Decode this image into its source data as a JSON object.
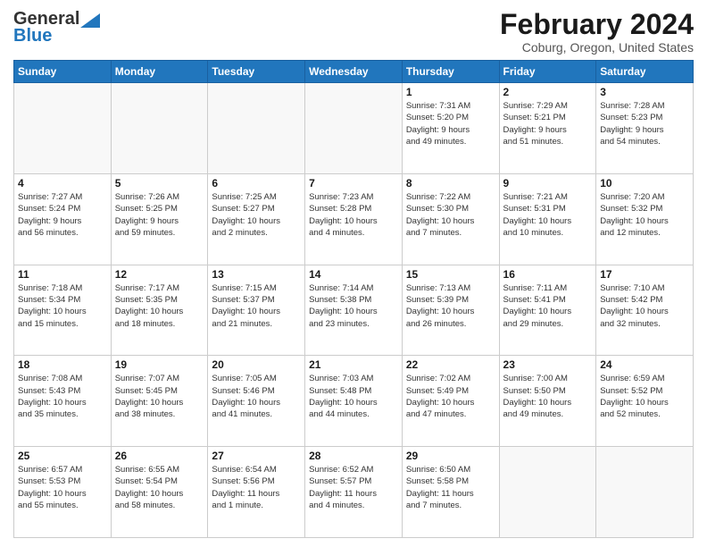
{
  "header": {
    "logo_general": "General",
    "logo_blue": "Blue",
    "month_title": "February 2024",
    "location": "Coburg, Oregon, United States"
  },
  "days_of_week": [
    "Sunday",
    "Monday",
    "Tuesday",
    "Wednesday",
    "Thursday",
    "Friday",
    "Saturday"
  ],
  "weeks": [
    [
      {
        "day": "",
        "info": ""
      },
      {
        "day": "",
        "info": ""
      },
      {
        "day": "",
        "info": ""
      },
      {
        "day": "",
        "info": ""
      },
      {
        "day": "1",
        "info": "Sunrise: 7:31 AM\nSunset: 5:20 PM\nDaylight: 9 hours\nand 49 minutes."
      },
      {
        "day": "2",
        "info": "Sunrise: 7:29 AM\nSunset: 5:21 PM\nDaylight: 9 hours\nand 51 minutes."
      },
      {
        "day": "3",
        "info": "Sunrise: 7:28 AM\nSunset: 5:23 PM\nDaylight: 9 hours\nand 54 minutes."
      }
    ],
    [
      {
        "day": "4",
        "info": "Sunrise: 7:27 AM\nSunset: 5:24 PM\nDaylight: 9 hours\nand 56 minutes."
      },
      {
        "day": "5",
        "info": "Sunrise: 7:26 AM\nSunset: 5:25 PM\nDaylight: 9 hours\nand 59 minutes."
      },
      {
        "day": "6",
        "info": "Sunrise: 7:25 AM\nSunset: 5:27 PM\nDaylight: 10 hours\nand 2 minutes."
      },
      {
        "day": "7",
        "info": "Sunrise: 7:23 AM\nSunset: 5:28 PM\nDaylight: 10 hours\nand 4 minutes."
      },
      {
        "day": "8",
        "info": "Sunrise: 7:22 AM\nSunset: 5:30 PM\nDaylight: 10 hours\nand 7 minutes."
      },
      {
        "day": "9",
        "info": "Sunrise: 7:21 AM\nSunset: 5:31 PM\nDaylight: 10 hours\nand 10 minutes."
      },
      {
        "day": "10",
        "info": "Sunrise: 7:20 AM\nSunset: 5:32 PM\nDaylight: 10 hours\nand 12 minutes."
      }
    ],
    [
      {
        "day": "11",
        "info": "Sunrise: 7:18 AM\nSunset: 5:34 PM\nDaylight: 10 hours\nand 15 minutes."
      },
      {
        "day": "12",
        "info": "Sunrise: 7:17 AM\nSunset: 5:35 PM\nDaylight: 10 hours\nand 18 minutes."
      },
      {
        "day": "13",
        "info": "Sunrise: 7:15 AM\nSunset: 5:37 PM\nDaylight: 10 hours\nand 21 minutes."
      },
      {
        "day": "14",
        "info": "Sunrise: 7:14 AM\nSunset: 5:38 PM\nDaylight: 10 hours\nand 23 minutes."
      },
      {
        "day": "15",
        "info": "Sunrise: 7:13 AM\nSunset: 5:39 PM\nDaylight: 10 hours\nand 26 minutes."
      },
      {
        "day": "16",
        "info": "Sunrise: 7:11 AM\nSunset: 5:41 PM\nDaylight: 10 hours\nand 29 minutes."
      },
      {
        "day": "17",
        "info": "Sunrise: 7:10 AM\nSunset: 5:42 PM\nDaylight: 10 hours\nand 32 minutes."
      }
    ],
    [
      {
        "day": "18",
        "info": "Sunrise: 7:08 AM\nSunset: 5:43 PM\nDaylight: 10 hours\nand 35 minutes."
      },
      {
        "day": "19",
        "info": "Sunrise: 7:07 AM\nSunset: 5:45 PM\nDaylight: 10 hours\nand 38 minutes."
      },
      {
        "day": "20",
        "info": "Sunrise: 7:05 AM\nSunset: 5:46 PM\nDaylight: 10 hours\nand 41 minutes."
      },
      {
        "day": "21",
        "info": "Sunrise: 7:03 AM\nSunset: 5:48 PM\nDaylight: 10 hours\nand 44 minutes."
      },
      {
        "day": "22",
        "info": "Sunrise: 7:02 AM\nSunset: 5:49 PM\nDaylight: 10 hours\nand 47 minutes."
      },
      {
        "day": "23",
        "info": "Sunrise: 7:00 AM\nSunset: 5:50 PM\nDaylight: 10 hours\nand 49 minutes."
      },
      {
        "day": "24",
        "info": "Sunrise: 6:59 AM\nSunset: 5:52 PM\nDaylight: 10 hours\nand 52 minutes."
      }
    ],
    [
      {
        "day": "25",
        "info": "Sunrise: 6:57 AM\nSunset: 5:53 PM\nDaylight: 10 hours\nand 55 minutes."
      },
      {
        "day": "26",
        "info": "Sunrise: 6:55 AM\nSunset: 5:54 PM\nDaylight: 10 hours\nand 58 minutes."
      },
      {
        "day": "27",
        "info": "Sunrise: 6:54 AM\nSunset: 5:56 PM\nDaylight: 11 hours\nand 1 minute."
      },
      {
        "day": "28",
        "info": "Sunrise: 6:52 AM\nSunset: 5:57 PM\nDaylight: 11 hours\nand 4 minutes."
      },
      {
        "day": "29",
        "info": "Sunrise: 6:50 AM\nSunset: 5:58 PM\nDaylight: 11 hours\nand 7 minutes."
      },
      {
        "day": "",
        "info": ""
      },
      {
        "day": "",
        "info": ""
      }
    ]
  ]
}
